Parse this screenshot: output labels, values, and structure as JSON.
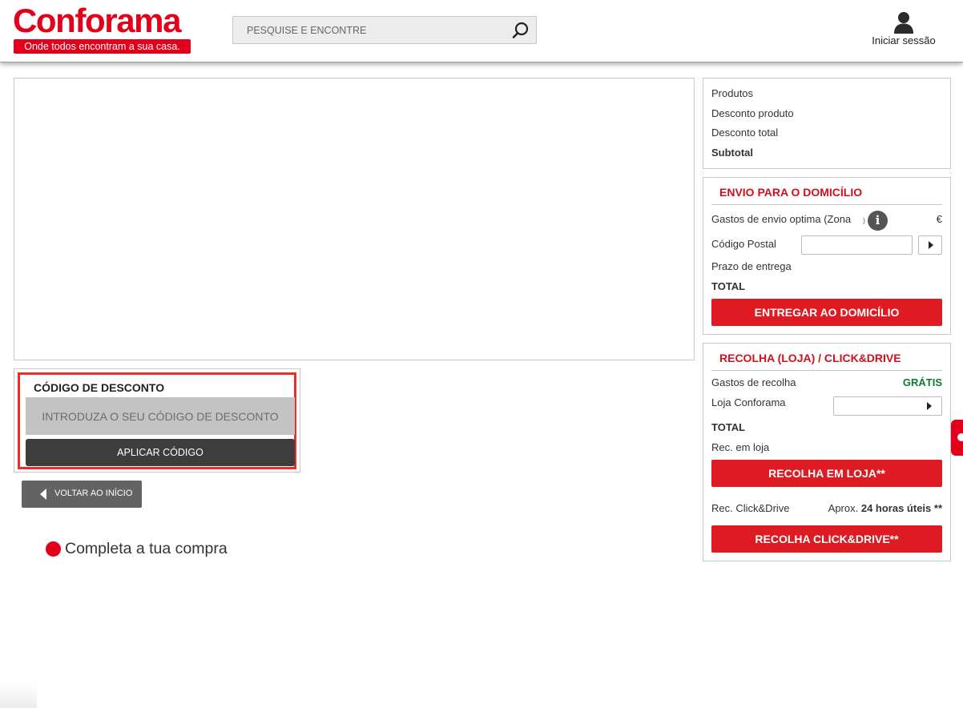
{
  "brand": {
    "name": "Conforama",
    "tagline": "Onde todos encontram a sua casa.",
    "accent_color": "#e2001a"
  },
  "header": {
    "search_placeholder": "PESQUISE E ENCONTRE",
    "search_icon": "search-icon",
    "login_label": "Iniciar sessão",
    "login_icon": "user-icon"
  },
  "discount": {
    "title": "CÓDIGO DE DESCONTO",
    "placeholder": "INTRODUZA O SEU CÓDIGO DE DESCONTO",
    "apply_label": "APLICAR CÓDIGO"
  },
  "back": {
    "label": "VOLTAR AO INÍCIO",
    "icon": "caret-left-icon"
  },
  "complete_label": "Completa a tua compra",
  "summary": {
    "products": "Produtos",
    "product_discount": "Desconto produto",
    "total_discount": "Desconto total",
    "subtotal": "Subtotal"
  },
  "delivery": {
    "title": "ENVIO PARA O DOMICÍLIO",
    "shipping_costs": "Gastos de envio optima  (Zona",
    "paren_close": ")",
    "info_icon_glyph": "i",
    "currency": "€",
    "postal_code": "Código Postal",
    "delivery_time": "Prazo de entrega",
    "total": "TOTAL",
    "button": "ENTREGAR AO DOMICÍLIO"
  },
  "pickup": {
    "title": "RECOLHA (LOJA) / CLICK&DRIVE",
    "pickup_costs": "Gastos de recolha",
    "free": "GRÁTIS",
    "store": "Loja Conforama",
    "total": "TOTAL",
    "rec_store": "Rec. em loja",
    "store_button": "RECOLHA EM LOJA**",
    "rec_click": "Rec. Click&Drive",
    "aprox_prefix": "Aprox. ",
    "aprox_time": "24 horas úteis **",
    "click_button": "RECOLHA CLICK&DRIVE**",
    "free_color": "#0d7a2c"
  }
}
